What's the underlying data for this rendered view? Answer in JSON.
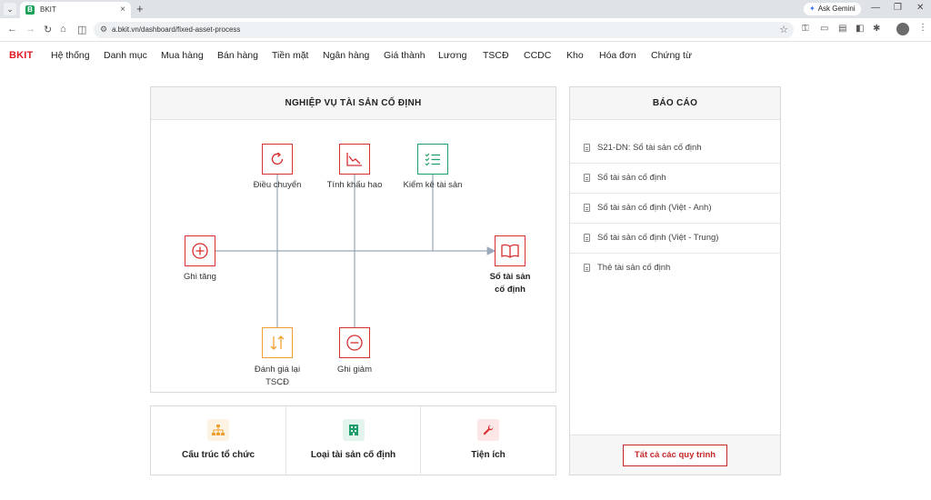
{
  "browser": {
    "tab_title": "BKIT",
    "tab_favicon": "B",
    "url": "a.bkit.vn/dashboard/fixed-asset-process",
    "ask_gemini": "Ask Gemini"
  },
  "nav": {
    "brand": "BKIT",
    "items": [
      "Hệ thống",
      "Danh mục",
      "Mua hàng",
      "Bán hàng",
      "Tiền mặt",
      "Ngân hàng",
      "Giá thành",
      "Lương",
      "TSCĐ",
      "CCDC",
      "Kho",
      "Hóa đơn",
      "Chứng từ"
    ]
  },
  "process_panel": {
    "title": "NGHIỆP VỤ TÀI SẢN CỐ ĐỊNH",
    "nodes": {
      "transfer": {
        "label": "Điều chuyển",
        "icon": "refresh-icon",
        "color": "#d63031"
      },
      "depreciation": {
        "label": "Tính khấu hao",
        "icon": "line-chart-icon",
        "color": "#d63031"
      },
      "inventory": {
        "label": "Kiểm kê tài sản",
        "icon": "checklist-icon",
        "color": "#1e9e6a"
      },
      "increase": {
        "label": "Ghi tăng",
        "icon": "plus-circle-icon",
        "color": "#d63031"
      },
      "ledger": {
        "label_line1": "Sổ tài sản",
        "label_line2": "cố định",
        "icon": "book-icon",
        "color": "#d63031"
      },
      "revaluation": {
        "label_line1": "Đánh giá lại",
        "label_line2": "TSCĐ",
        "icon": "swap-vertical-icon",
        "color": "#f0a030"
      },
      "decrease": {
        "label": "Ghi giảm",
        "icon": "minus-circle-icon",
        "color": "#d63031"
      }
    }
  },
  "report_panel": {
    "title": "BÁO CÁO",
    "items": [
      "S21-DN: Sổ tài sản cố định",
      "Sổ tài sản cố định",
      "Sổ tài sản cố định (Việt - Anh)",
      "Sổ tài sản cố định (Việt - Trung)",
      "Thẻ tài sản cố định"
    ],
    "all_button": "Tất cả các quy trình"
  },
  "cards": [
    {
      "label": "Cấu trúc tổ chức",
      "icon": "org-chart-icon",
      "color": "#f0a030"
    },
    {
      "label": "Loại tài sản cố định",
      "icon": "building-icon",
      "color": "#1e9e6a"
    },
    {
      "label": "Tiện ích",
      "icon": "wrench-icon",
      "color": "#d63031"
    }
  ],
  "colors": {
    "brand": "#e01b24",
    "accent_red": "#d63031",
    "accent_green": "#1e9e6a",
    "accent_orange": "#f0a030",
    "connector": "#9aa7b8"
  }
}
